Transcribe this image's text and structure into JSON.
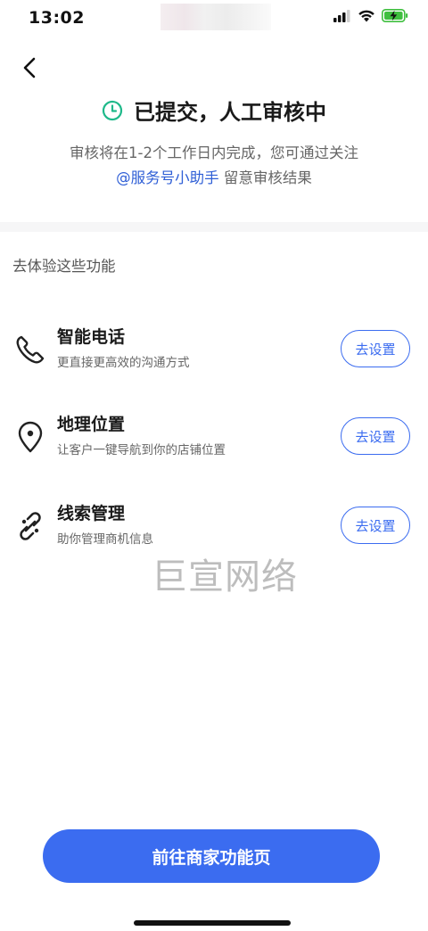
{
  "status_bar": {
    "time": "13:02",
    "icons": [
      "signal-icon",
      "wifi-icon",
      "battery-charging-icon"
    ],
    "battery_color": "#3fbf3f"
  },
  "header": {
    "back_icon": "chevron-left-icon"
  },
  "result": {
    "icon": "clock-icon",
    "icon_color": "#1fb98a",
    "title": "已提交，人工审核中",
    "desc_line1": "审核将在1-2个工作日内完成，您可通过关注",
    "desc_link": "@服务号小助手",
    "desc_line2_suffix": " 留意审核结果"
  },
  "section": {
    "title": "去体验这些功能"
  },
  "features": [
    {
      "icon": "phone-icon",
      "name": "智能电话",
      "desc": "更直接更高效的沟通方式",
      "button": "去设置"
    },
    {
      "icon": "location-pin-icon",
      "name": "地理位置",
      "desc": "让客户一键导航到你的店铺位置",
      "button": "去设置"
    },
    {
      "icon": "link-icon",
      "name": "线索管理",
      "desc": "助你管理商机信息",
      "button": "去设置"
    }
  ],
  "watermark": "巨宣网络",
  "footer": {
    "primary_button": "前往商家功能页"
  },
  "colors": {
    "accent": "#3b6cf0",
    "link": "#2f5fd6",
    "success": "#1fb98a"
  }
}
